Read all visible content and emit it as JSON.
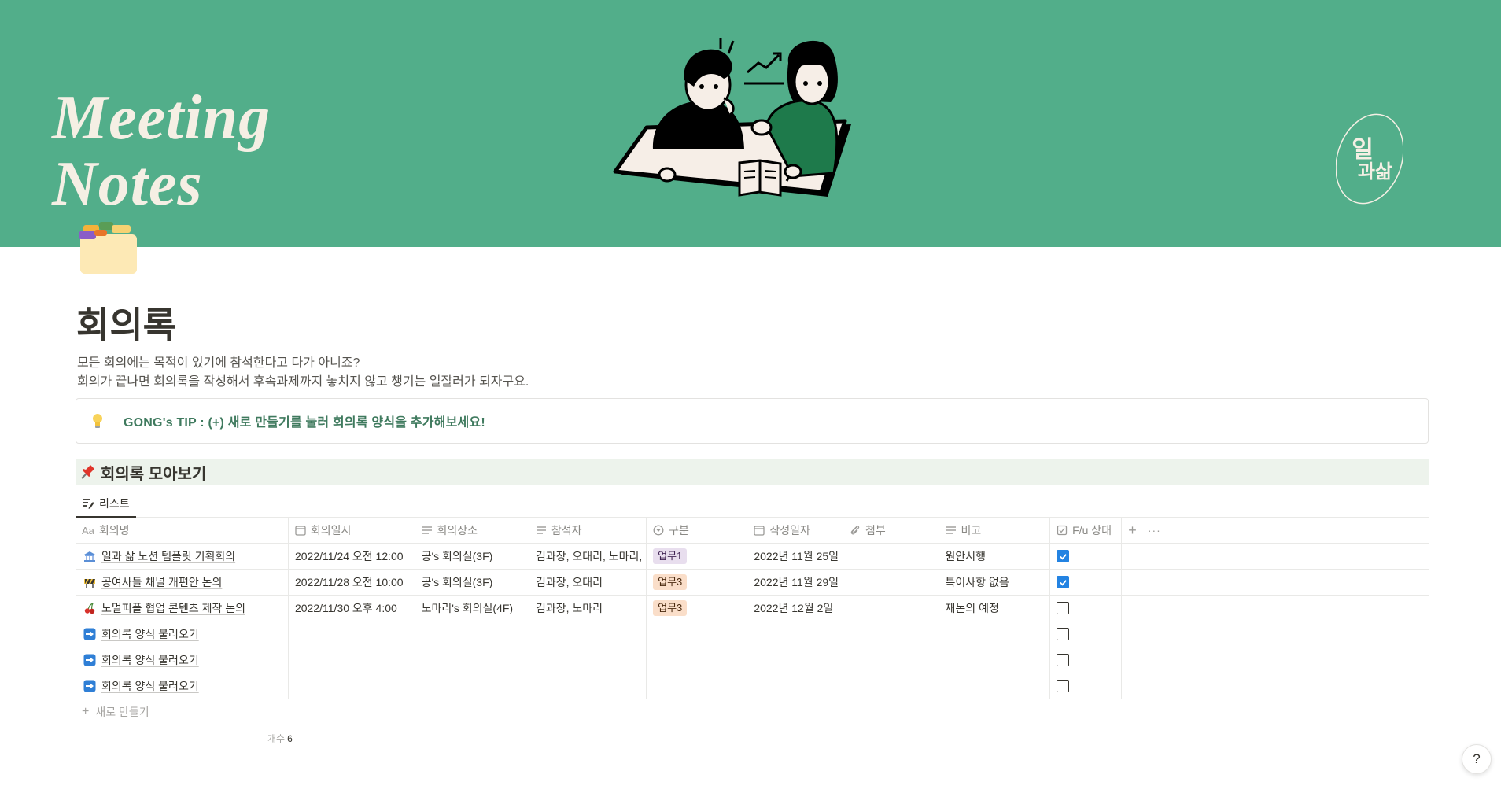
{
  "banner": {
    "title_line1": "Meeting",
    "title_line2": "Notes",
    "logo_line1": "일",
    "logo_line2": "과삶",
    "color": "#52ae8a"
  },
  "page": {
    "icon": "card-index-folder-icon",
    "title": "회의록",
    "description": [
      "모든 회의에는 목적이 있기에 참석한다고 다가 아니죠?",
      "회의가 끝나면 회의록을 작성해서 후속과제까지 놓치지 않고 챙기는 일잘러가 되자구요."
    ]
  },
  "callout": {
    "icon": "light-bulb-icon",
    "text": "GONG's TIP : (+) 새로 만들기를 눌러 회의록 양식을 추가해보세요!"
  },
  "section": {
    "icon": "pushpin-icon",
    "title": "회의록 모아보기"
  },
  "view_tab": {
    "icon": "list-view-icon",
    "label": "리스트"
  },
  "table": {
    "columns": [
      {
        "label": "회의명",
        "icon": "Aa"
      },
      {
        "label": "회의일시",
        "icon": "calendar-icon"
      },
      {
        "label": "회의장소",
        "icon": "text-lines-icon"
      },
      {
        "label": "참석자",
        "icon": "text-lines-icon"
      },
      {
        "label": "구분",
        "icon": "select-icon"
      },
      {
        "label": "작성일자",
        "icon": "calendar-icon"
      },
      {
        "label": "첨부",
        "icon": "paperclip-icon"
      },
      {
        "label": "비고",
        "icon": "text-lines-icon"
      },
      {
        "label": "F/u 상태",
        "icon": "checkbox-icon"
      }
    ],
    "add_column": "+",
    "more": "···",
    "rows": [
      {
        "icon": "bank-icon",
        "name": "일과 삶 노션 템플릿 기획회의",
        "datetime": "2022/11/24 오전 12:00",
        "place": "공's 회의실(3F)",
        "attendees": "김과장, 오대리, 노마리,",
        "type": "업무1",
        "written": "2022년 11월 25일",
        "attach": "",
        "note": "원안시행",
        "done": true
      },
      {
        "icon": "construction-icon",
        "name": "공여사들 채널 개편안 논의",
        "datetime": "2022/11/28 오전 10:00",
        "place": "공's 회의실(3F)",
        "attendees": "김과장, 오대리",
        "type": "업무3",
        "written": "2022년 11월 29일",
        "attach": "",
        "note": "특이사항 없음",
        "done": true
      },
      {
        "icon": "cherries-icon",
        "name": "노멀피플 협업 콘텐츠 제작 논의",
        "datetime": "2022/11/30 오후 4:00",
        "place": "노마리's 회의실(4F)",
        "attendees": "김과장, 노마리",
        "type": "업무3",
        "written": "2022년 12월 2일",
        "attach": "",
        "note": "재논의 예정",
        "done": false
      },
      {
        "icon": "right-arrow-icon",
        "name": "회의록 양식 불러오기",
        "datetime": "",
        "place": "",
        "attendees": "",
        "type": "",
        "written": "",
        "attach": "",
        "note": "",
        "done": false
      },
      {
        "icon": "right-arrow-icon",
        "name": "회의록 양식 불러오기",
        "datetime": "",
        "place": "",
        "attendees": "",
        "type": "",
        "written": "",
        "attach": "",
        "note": "",
        "done": false
      },
      {
        "icon": "right-arrow-icon",
        "name": "회의록 양식 불러오기",
        "datetime": "",
        "place": "",
        "attendees": "",
        "type": "",
        "written": "",
        "attach": "",
        "note": "",
        "done": false
      }
    ],
    "tag_colors": {
      "업무1": {
        "bg": "#e8deee",
        "fg": "#412454"
      },
      "업무3": {
        "bg": "#fadec9",
        "fg": "#49290e"
      }
    },
    "new_row_label": "새로 만들기",
    "count_label": "개수",
    "count_value": "6"
  },
  "help": "?"
}
